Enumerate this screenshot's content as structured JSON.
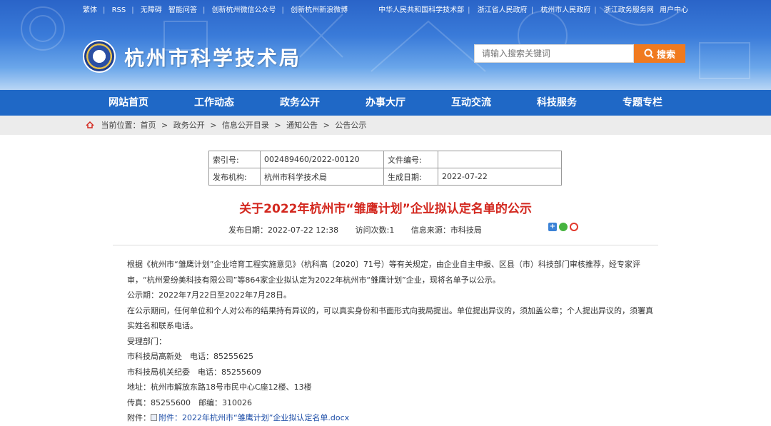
{
  "top_links_left": [
    "繁体",
    "RSS",
    "无障碍",
    "智能问答",
    "创新杭州微信公众号",
    "创新杭州新浪微博"
  ],
  "top_links_right": [
    "中华人民共和国科学技术部",
    "浙江省人民政府",
    "杭州市人民政府",
    "浙江政务服务网",
    "用户中心"
  ],
  "site_title": "杭州市科学技术局",
  "search": {
    "placeholder": "请输入搜索关键词",
    "button_label": "搜索"
  },
  "nav": [
    "网站首页",
    "工作动态",
    "政务公开",
    "办事大厅",
    "互动交流",
    "科技服务",
    "专题专栏"
  ],
  "breadcrumb": {
    "prefix": "当前位置：",
    "items": [
      "首页",
      "政务公开",
      "信息公开目录",
      "通知公告",
      "公告公示"
    ],
    "arrow": ">"
  },
  "meta": {
    "index_label": "索引号:",
    "index_value": "002489460/2022-00120",
    "doc_no_label": "文件编号:",
    "doc_no_value": "",
    "publisher_label": "发布机构:",
    "publisher_value": "杭州市科学技术局",
    "date_label": "生成日期:",
    "date_value": "2022-07-22"
  },
  "article": {
    "title": "关于2022年杭州市“雏鹰计划”企业拟认定名单的公示",
    "publish_date": "发布日期：2022-07-22 12:38",
    "visits": "访问次数:1",
    "source": "信息来源：市科技局",
    "paragraphs": {
      "p1": "根据《杭州市“雏鹰计划”企业培育工程实施意见》（杭科高〔2020〕71号）等有关规定，由企业自主申报、区县（市）科技部门审核推荐，经专家评审，“杭州爱纷美科技有限公司”等864家企业拟认定为2022年杭州市“雏鹰计划”企业，现将名单予以公示。",
      "p2": "公示期：2022年7月22日至2022年7月28日。",
      "p3": "在公示期间，任何单位和个人对公布的结果持有异议的，可以真实身份和书面形式向我局提出。单位提出异议的，须加盖公章；个人提出异议的，须署真实姓名和联系电话。",
      "p4": "受理部门：",
      "p5": "市科技局高新处　电话：85255625",
      "p6": "市科技局机关纪委　电话：85255609",
      "p7": "地址：杭州市解放东路18号市民中心C座12楼、13楼",
      "p8": "传真：85255600　邮编：310026",
      "attachment_label": "附件：",
      "attachment_link": "附件：2022年杭州市“雏鹰计划”企业拟认定名单.docx"
    }
  },
  "colors": {
    "nav_bg": "#1f68c6",
    "title_red": "#d3281f",
    "search_orange": "#f07a1f"
  }
}
